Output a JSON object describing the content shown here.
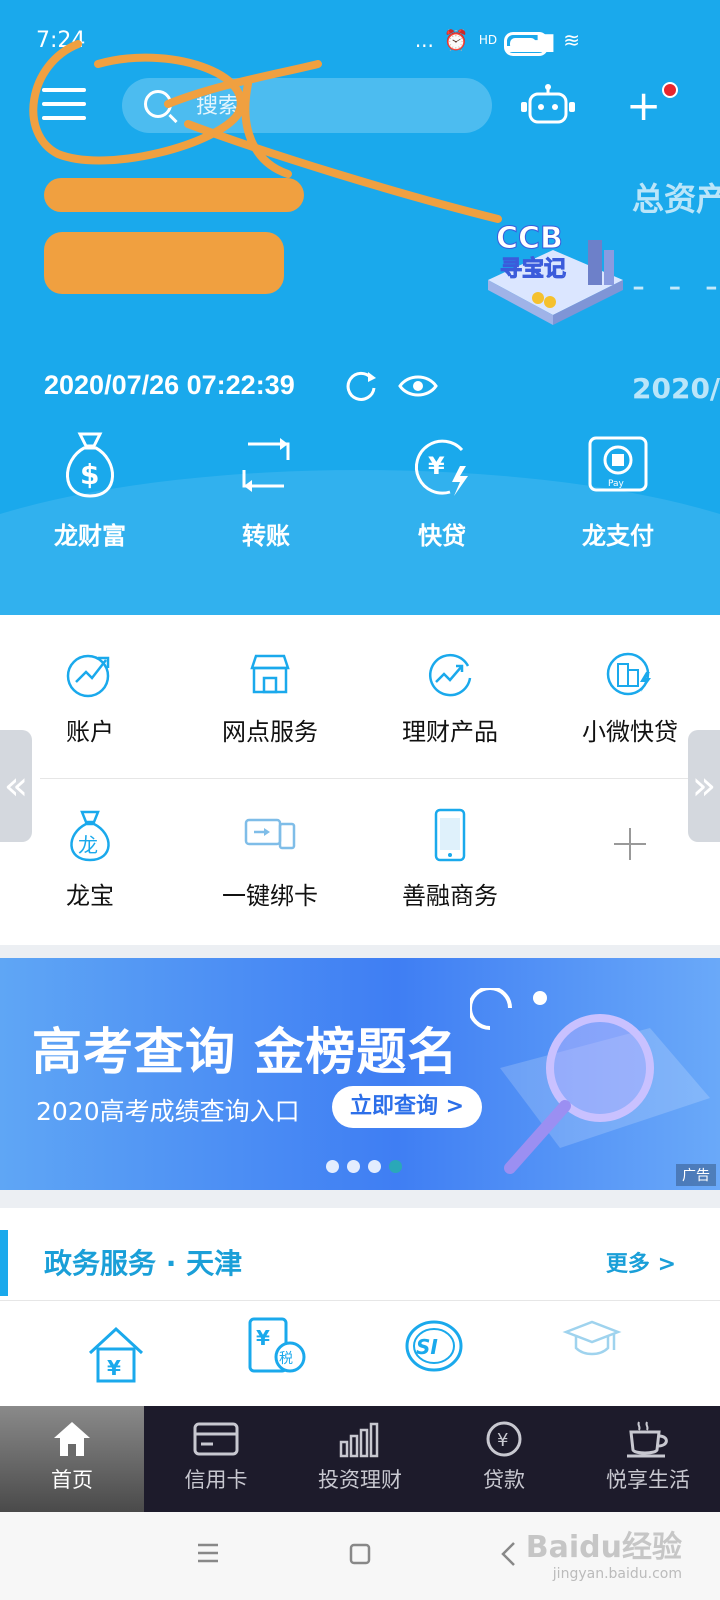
{
  "status_bar": {
    "time": "7:24",
    "network": "HD",
    "dots": "..."
  },
  "header": {
    "search_placeholder": "搜索",
    "total_assets_label": "总资产",
    "total_assets_value": "- - - - -",
    "datetime": "2020/07/26 07:22:39",
    "datetime_right": "2020/0"
  },
  "quick_actions": [
    {
      "label": "龙财富",
      "icon": "money-bag-icon"
    },
    {
      "label": "转账",
      "icon": "transfer-icon"
    },
    {
      "label": "快贷",
      "icon": "quick-loan-icon"
    },
    {
      "label": "龙支付",
      "icon": "pay-icon"
    }
  ],
  "grid": [
    {
      "label": "账户",
      "icon": "account-icon"
    },
    {
      "label": "网点服务",
      "icon": "branch-icon"
    },
    {
      "label": "理财产品",
      "icon": "wealth-chart-icon"
    },
    {
      "label": "小微快贷",
      "icon": "smb-loan-icon"
    },
    {
      "label": "龙宝",
      "icon": "dragon-bag-icon"
    },
    {
      "label": "一键绑卡",
      "icon": "bind-card-icon"
    },
    {
      "label": "善融商务",
      "icon": "phone-shop-icon"
    }
  ],
  "banner": {
    "title": "高考查询 金榜题名",
    "subtitle": "2020高考成绩查询入口",
    "button": "立即查询 >",
    "ad_tag": "广告"
  },
  "gov_section": {
    "title": "政务服务 · 天津",
    "more": "更多 >"
  },
  "tabbar": [
    {
      "label": "首页",
      "icon": "home-icon"
    },
    {
      "label": "信用卡",
      "icon": "credit-card-icon"
    },
    {
      "label": "投资理财",
      "icon": "bar-chart-icon"
    },
    {
      "label": "贷款",
      "icon": "yen-coin-icon"
    },
    {
      "label": "悦享生活",
      "icon": "coffee-cup-icon"
    }
  ],
  "watermark": {
    "brand": "Baidu经验",
    "url": "jingyan.baidu.com"
  },
  "colors": {
    "primary": "#1aa9ec",
    "tabbar": "#1d1b2b",
    "accent_text": "#1a9fd8",
    "redaction": "#f0a040"
  }
}
